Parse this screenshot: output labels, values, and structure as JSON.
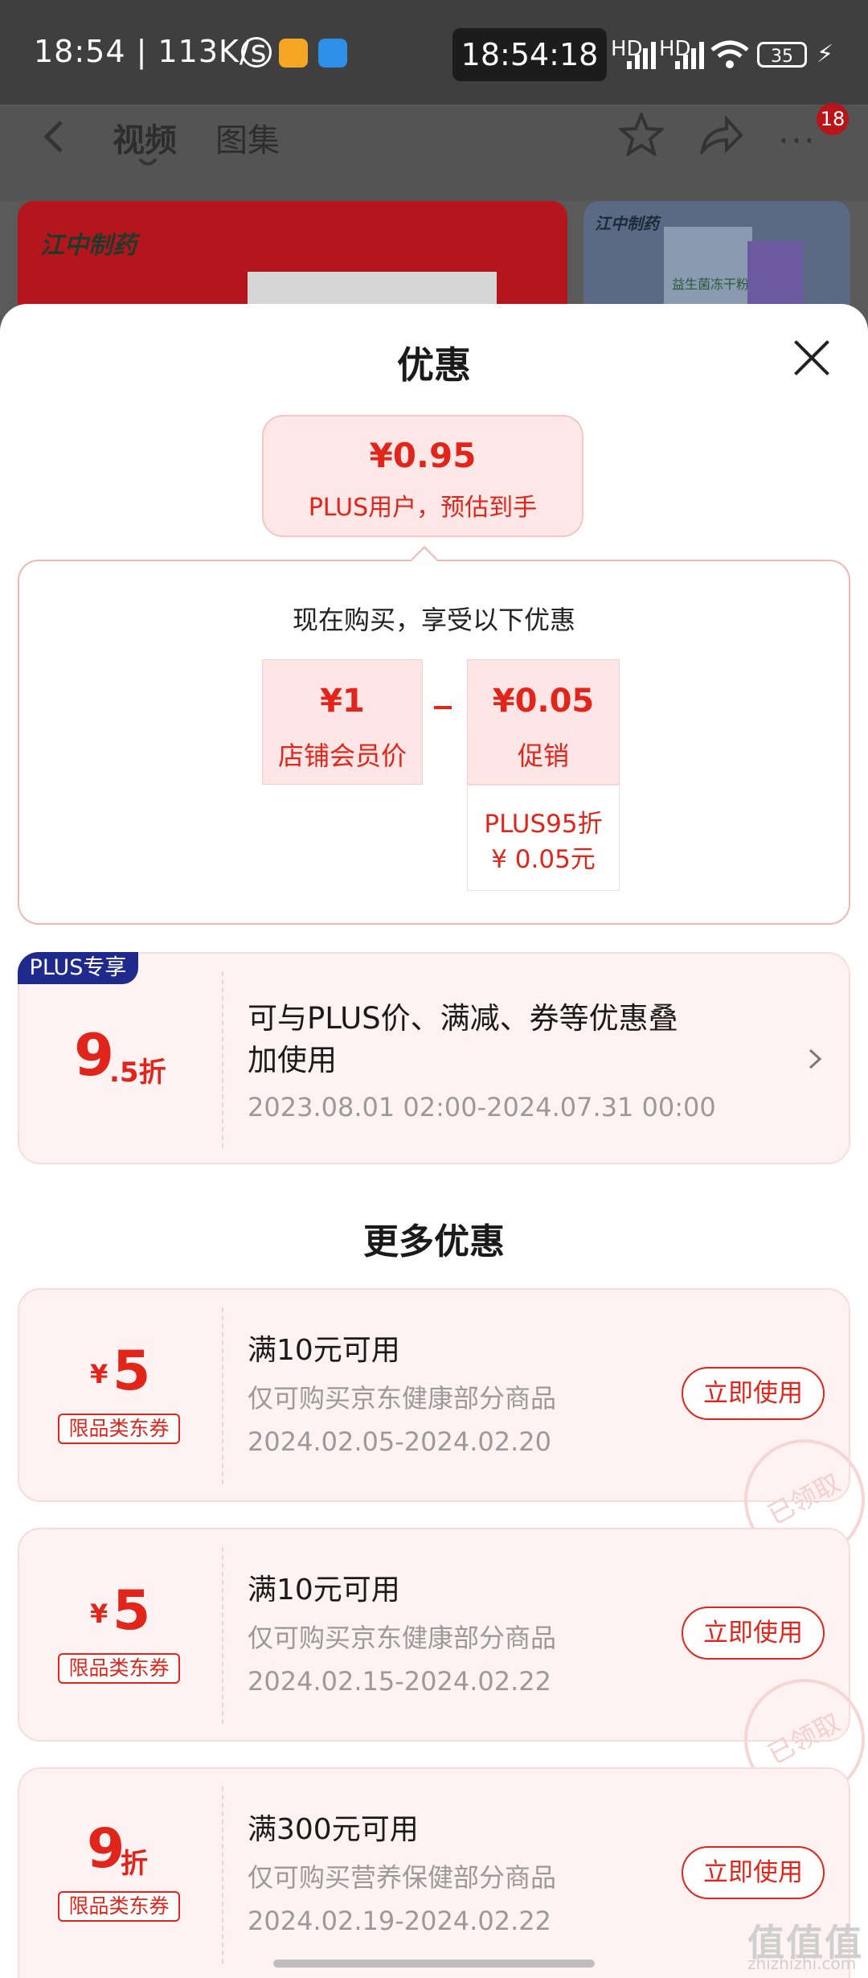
{
  "status_bar": {
    "left_text": "18:54 | 113K/s",
    "center_time": "18:54:18",
    "hd1": "HD",
    "hd2": "HD",
    "battery": "35"
  },
  "header": {
    "tab_video": "视频",
    "tab_gallery": "图集",
    "badge": "18"
  },
  "background_cards": {
    "brand1": "江中制药",
    "brand2": "江中制药",
    "product2": "益生菌冻干粉"
  },
  "sheet": {
    "title": "优惠",
    "estimate_price": "¥0.95",
    "estimate_label": "PLUS用户，预估到手",
    "buy_now_title": "现在购买，享受以下优惠",
    "member_price_value": "¥1",
    "member_price_label": "店铺会员价",
    "promo_value": "¥0.05",
    "promo_label": "促销",
    "promo_detail_line1": "PLUS95折",
    "promo_detail_line2": "¥ 0.05元"
  },
  "plus_coupon": {
    "badge": "PLUS专享",
    "discount_big": "9",
    "discount_small": ".5折",
    "desc_line1": "可与PLUS价、满减、券等优惠叠",
    "desc_line2": "加使用",
    "date": "2023.08.01 02:00-2024.07.31 00:00"
  },
  "more_title": "更多优惠",
  "coupons": [
    {
      "currency": "¥",
      "amount": "5",
      "tag": "限品类东券",
      "title": "满10元可用",
      "desc": "仅可购买京东健康部分商品",
      "date": "2024.02.05-2024.02.20",
      "button": "立即使用",
      "stamp": "已领取"
    },
    {
      "currency": "¥",
      "amount": "5",
      "tag": "限品类东券",
      "title": "满10元可用",
      "desc": "仅可购买京东健康部分商品",
      "date": "2024.02.15-2024.02.22",
      "button": "立即使用",
      "stamp": "已领取"
    },
    {
      "amount": "9",
      "unit": "折",
      "tag": "限品类东券",
      "title": "满300元可用",
      "desc": "仅可购买营养保健部分商品",
      "date": "2024.02.19-2024.02.22",
      "button": "立即使用"
    }
  ],
  "watermark": {
    "logo": "值值值",
    "url": "zhizhizhi.com"
  }
}
